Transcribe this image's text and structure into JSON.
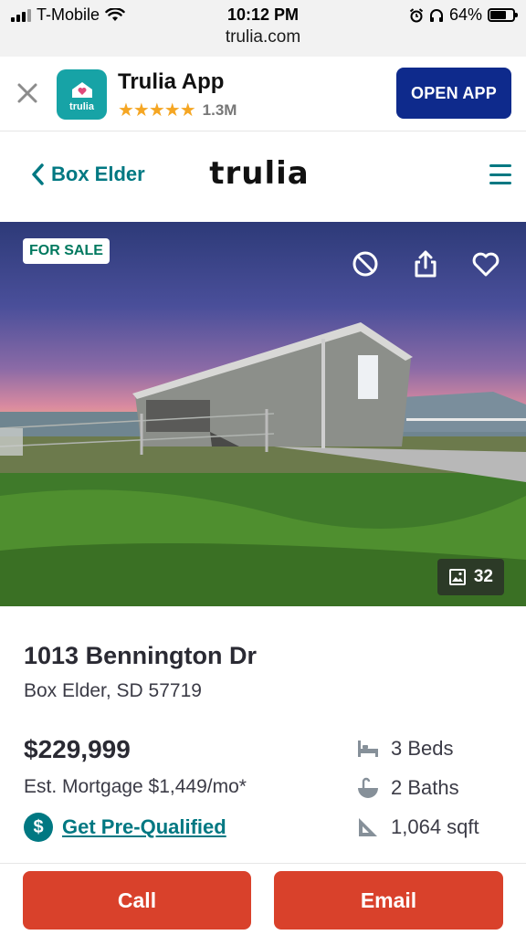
{
  "status_bar": {
    "carrier": "T-Mobile",
    "time": "10:12 PM",
    "url": "trulia.com",
    "battery": "64%",
    "battery_level": 0.64,
    "icons": [
      "signal-icon",
      "wifi-icon",
      "alarm-icon",
      "headphones-icon",
      "battery-icon"
    ]
  },
  "app_banner": {
    "app_name": "Trulia App",
    "icon_text": "trulia",
    "stars": "★★★★★",
    "rating_count": "1.3M",
    "open_label": "OPEN APP"
  },
  "nav": {
    "back_label": "Box Elder",
    "logo": "trulia"
  },
  "hero": {
    "badge": "FOR SALE",
    "photo_count": "32"
  },
  "listing": {
    "address": "1013 Bennington Dr",
    "city_line": "Box Elder, SD 57719",
    "price": "$229,999",
    "mortgage": "Est. Mortgage $1,449/mo*",
    "prequal_label": "Get Pre-Qualified",
    "beds": "3 Beds",
    "baths": "2 Baths",
    "sqft": "1,064 sqft"
  },
  "actions": {
    "call_label": "Call",
    "email_label": "Email"
  },
  "colors": {
    "accent": "#007882",
    "banner_button": "#0e2a8c",
    "cta": "#d9412b",
    "sale_badge_text": "#00795f"
  }
}
